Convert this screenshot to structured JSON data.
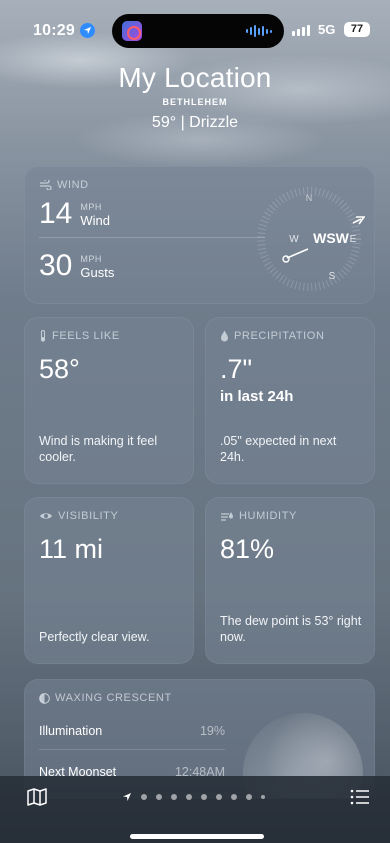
{
  "status_bar": {
    "time": "10:29",
    "network": "5G",
    "battery": "77"
  },
  "header": {
    "title": "My Location",
    "subtitle": "BETHLEHEM",
    "conditions": "59° | Drizzle"
  },
  "wind": {
    "heading": "WIND",
    "wind_speed": "14",
    "wind_unit": "MPH",
    "wind_label": "Wind",
    "gust_speed": "30",
    "gust_unit": "MPH",
    "gust_label": "Gusts",
    "direction": "WSW",
    "compass": {
      "n": "N",
      "e": "E",
      "s": "S",
      "w": "W"
    }
  },
  "feels_like": {
    "heading": "FEELS LIKE",
    "value": "58°",
    "note": "Wind is making it feel cooler."
  },
  "precipitation": {
    "heading": "PRECIPITATION",
    "value": ".7\"",
    "sub": "in last 24h",
    "note": ".05\" expected in next 24h."
  },
  "visibility": {
    "heading": "VISIBILITY",
    "value": "11 mi",
    "note": "Perfectly clear view."
  },
  "humidity": {
    "heading": "HUMIDITY",
    "value": "81%",
    "note": "The dew point is 53° right now."
  },
  "moon": {
    "heading": "WAXING CRESCENT",
    "illumination_label": "Illumination",
    "illumination_value": "19%",
    "moonset_label": "Next Moonset",
    "moonset_value": "12:48AM"
  },
  "colors": {
    "accent_blue": "#2f8cff",
    "card_bg": "#76849480"
  }
}
